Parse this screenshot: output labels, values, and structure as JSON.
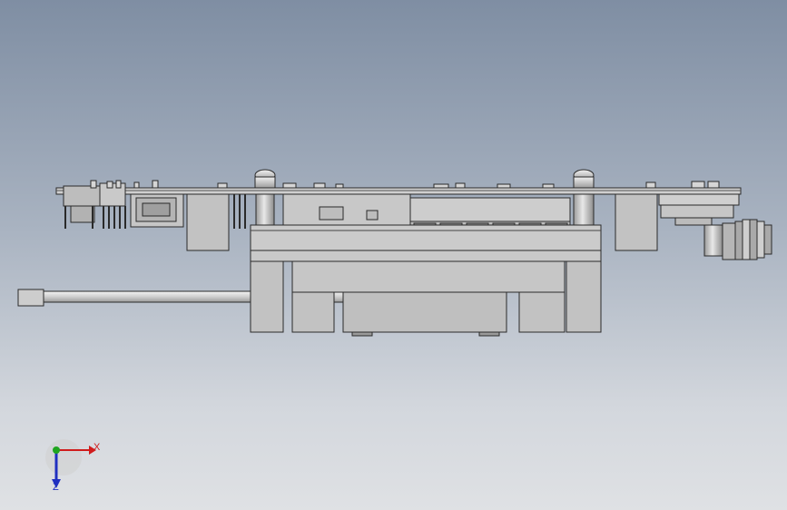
{
  "viewport": {
    "background_top": "#7f8ea3",
    "background_bottom": "#dfe1e4"
  },
  "model": {
    "icon": "cad-assembly-side-view",
    "fill_color": "#c4c4c4",
    "edge_color": "#2a2a2a",
    "shaft_color": "#e6e6e6"
  },
  "triad": {
    "x_label": "X",
    "z_label": "Z",
    "x_color": "#d01c1c",
    "y_color": "#1fa51f",
    "z_color": "#2030c0"
  }
}
